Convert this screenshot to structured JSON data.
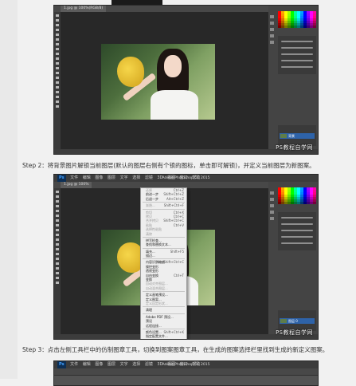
{
  "steps": {
    "step2": "Step 2：将背景图片解锁当前图层(默认的图层右侧有个锁的图标，单击即可解锁)，并定义当前图层为新图案。",
    "step3": "Step 3：点击左侧工具栏中的仿制图章工具，切换到图案图章工具，在生成的图案选择栏里找到生成的新定义图案。"
  },
  "screenshots": {
    "shot1": {
      "tab": "1.jpg @ 100%(RGB/8)",
      "layer_name": "背景",
      "watermark": "PS教程自学网"
    },
    "shot2": {
      "logo": "Ps",
      "menus": [
        "文件",
        "编辑",
        "图像",
        "图层",
        "文字",
        "选择",
        "滤镜",
        "3D",
        "视图",
        "窗口",
        "帮助"
      ],
      "app_title": "Adobe Photoshop CC 2015",
      "tab": "1.jpg @ 100%",
      "layer_name": "图层 0",
      "watermark": "PS教程自学网",
      "edit_menu": [
        {
          "label": "还原",
          "shortcut": "Ctrl+Z",
          "dim": true
        },
        {
          "label": "前进一步",
          "shortcut": "Shift+Ctrl+Z",
          "dim": false
        },
        {
          "label": "后退一步",
          "shortcut": "Alt+Ctrl+Z",
          "dim": false
        },
        {
          "sep": true
        },
        {
          "label": "渐隐...",
          "shortcut": "Shift+Ctrl+F",
          "dim": true
        },
        {
          "sep": true
        },
        {
          "label": "剪切",
          "shortcut": "Ctrl+X",
          "dim": true
        },
        {
          "label": "拷贝",
          "shortcut": "Ctrl+C",
          "dim": true
        },
        {
          "label": "合并拷贝",
          "shortcut": "Shift+Ctrl+C",
          "dim": true
        },
        {
          "label": "粘贴",
          "shortcut": "Ctrl+V",
          "dim": true
        },
        {
          "label": "选择性粘贴",
          "shortcut": "",
          "dim": true
        },
        {
          "label": "清除",
          "shortcut": "",
          "dim": true
        },
        {
          "sep": true
        },
        {
          "label": "拼写检查...",
          "shortcut": "",
          "dim": false
        },
        {
          "label": "查找和替换文本...",
          "shortcut": "",
          "dim": false
        },
        {
          "sep": true
        },
        {
          "label": "填充...",
          "shortcut": "Shift+F5",
          "dim": false
        },
        {
          "label": "描边...",
          "shortcut": "",
          "dim": false
        },
        {
          "sep": true
        },
        {
          "label": "内容识别缩放",
          "shortcut": "Alt+Shift+Ctrl+C",
          "dim": false
        },
        {
          "label": "操控变形",
          "shortcut": "",
          "dim": false
        },
        {
          "label": "透视变形",
          "shortcut": "",
          "dim": false
        },
        {
          "label": "自由变换",
          "shortcut": "Ctrl+T",
          "dim": false
        },
        {
          "label": "变换",
          "shortcut": "",
          "dim": false
        },
        {
          "label": "自动对齐图层...",
          "shortcut": "",
          "dim": true
        },
        {
          "label": "自动混合图层...",
          "shortcut": "",
          "dim": true
        },
        {
          "sep": true
        },
        {
          "label": "定义画笔预设...",
          "shortcut": "",
          "dim": false
        },
        {
          "label": "定义图案...",
          "shortcut": "",
          "dim": false
        },
        {
          "label": "定义自定形状...",
          "shortcut": "",
          "dim": true
        },
        {
          "sep": true
        },
        {
          "label": "清理",
          "shortcut": "",
          "dim": false
        },
        {
          "sep": true
        },
        {
          "label": "Adobe PDF 预设...",
          "shortcut": "",
          "dim": false
        },
        {
          "label": "预设",
          "shortcut": "",
          "dim": false
        },
        {
          "label": "远程连接...",
          "shortcut": "",
          "dim": false
        },
        {
          "sep": true
        },
        {
          "label": "颜色设置...",
          "shortcut": "Shift+Ctrl+K",
          "dim": false
        },
        {
          "label": "指定配置文件...",
          "shortcut": "",
          "dim": false
        },
        {
          "label": "转换为配置文件...",
          "shortcut": "",
          "dim": false
        }
      ]
    },
    "shot3": {
      "logo": "Ps",
      "menus": [
        "文件",
        "编辑",
        "图像",
        "图层",
        "文字",
        "选择",
        "滤镜",
        "3D",
        "视图",
        "窗口",
        "帮助"
      ],
      "app_title": "Adobe Photoshop CC 2015"
    }
  },
  "colors": {
    "ps_dark": "#535353",
    "menubar": "#3c3c3c",
    "accent": "#2e63a9"
  }
}
